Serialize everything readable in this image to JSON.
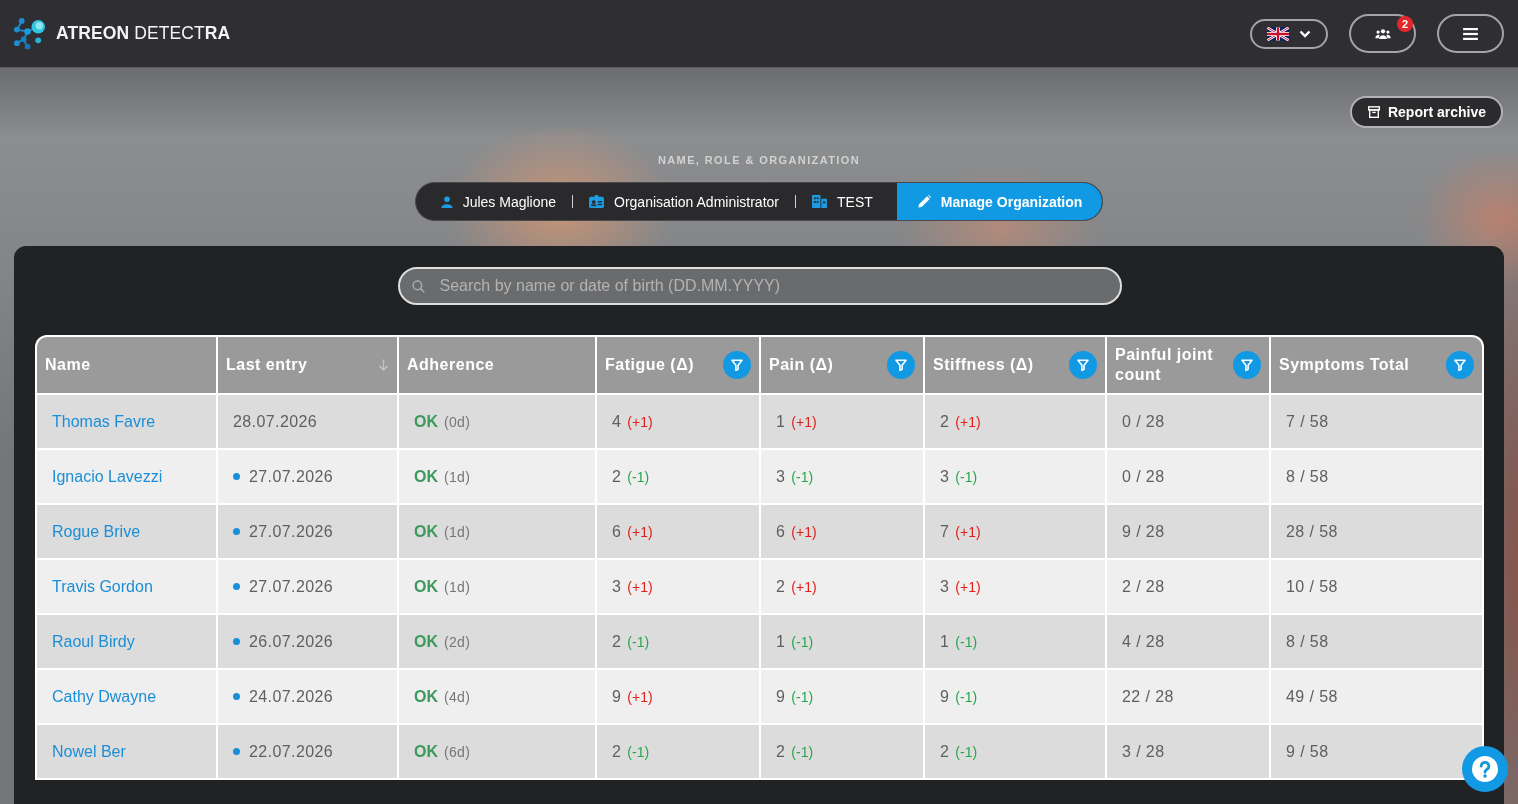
{
  "header": {
    "logo_text": "**ATREON** DETECT**RA**",
    "notification_count": "2"
  },
  "report_archive_button": "Report archive",
  "profile": {
    "section_label": "NAME, ROLE & ORGANIZATION",
    "name": "Jules Maglione",
    "role": "Organisation Administrator",
    "organization": "TEST",
    "manage_button": "Manage Organization"
  },
  "search": {
    "placeholder": "Search by name or date of birth (DD.MM.YYYY)"
  },
  "table": {
    "columns": [
      {
        "label": "Name",
        "filter": false,
        "sorted": false
      },
      {
        "label": "Last entry",
        "filter": false,
        "sorted": true
      },
      {
        "label": "Adherence",
        "filter": false,
        "sorted": false
      },
      {
        "label": "Fatigue (Δ)",
        "filter": true,
        "sorted": false
      },
      {
        "label": "Pain (Δ)",
        "filter": true,
        "sorted": false
      },
      {
        "label": "Stiffness (Δ)",
        "filter": true,
        "sorted": false
      },
      {
        "label": "Painful joint count",
        "filter": true,
        "sorted": false
      },
      {
        "label": "Symptoms Total",
        "filter": true,
        "sorted": false
      }
    ],
    "rows": [
      {
        "name": "Thomas Favre",
        "indicator": false,
        "last_entry": "28.07.2026",
        "adherence_status": "OK",
        "adherence_days": "(0d)",
        "scores": [
          {
            "value": "4",
            "delta": "(+1)",
            "increase": true
          },
          {
            "value": "1",
            "delta": "(+1)",
            "increase": true
          },
          {
            "value": "2",
            "delta": "(+1)",
            "increase": true
          }
        ],
        "painful_joint_count": "0 / 28",
        "symptoms_total": "7 / 58"
      },
      {
        "name": "Ignacio Lavezzi",
        "indicator": true,
        "last_entry": "27.07.2026",
        "adherence_status": "OK",
        "adherence_days": "(1d)",
        "scores": [
          {
            "value": "2",
            "delta": "(-1)",
            "increase": false
          },
          {
            "value": "3",
            "delta": "(-1)",
            "increase": false
          },
          {
            "value": "3",
            "delta": "(-1)",
            "increase": false
          }
        ],
        "painful_joint_count": "0 / 28",
        "symptoms_total": "8 / 58"
      },
      {
        "name": "Rogue Brive",
        "indicator": true,
        "last_entry": "27.07.2026",
        "adherence_status": "OK",
        "adherence_days": "(1d)",
        "scores": [
          {
            "value": "6",
            "delta": "(+1)",
            "increase": true
          },
          {
            "value": "6",
            "delta": "(+1)",
            "increase": true
          },
          {
            "value": "7",
            "delta": "(+1)",
            "increase": true
          }
        ],
        "painful_joint_count": "9 / 28",
        "symptoms_total": "28 / 58"
      },
      {
        "name": "Travis Gordon",
        "indicator": true,
        "last_entry": "27.07.2026",
        "adherence_status": "OK",
        "adherence_days": "(1d)",
        "scores": [
          {
            "value": "3",
            "delta": "(+1)",
            "increase": true
          },
          {
            "value": "2",
            "delta": "(+1)",
            "increase": true
          },
          {
            "value": "3",
            "delta": "(+1)",
            "increase": true
          }
        ],
        "painful_joint_count": "2 / 28",
        "symptoms_total": "10 / 58"
      },
      {
        "name": "Raoul Birdy",
        "indicator": true,
        "last_entry": "26.07.2026",
        "adherence_status": "OK",
        "adherence_days": "(2d)",
        "scores": [
          {
            "value": "2",
            "delta": "(-1)",
            "increase": false
          },
          {
            "value": "1",
            "delta": "(-1)",
            "increase": false
          },
          {
            "value": "1",
            "delta": "(-1)",
            "increase": false
          }
        ],
        "painful_joint_count": "4 / 28",
        "symptoms_total": "8 / 58"
      },
      {
        "name": "Cathy Dwayne",
        "indicator": true,
        "last_entry": "24.07.2026",
        "adherence_status": "OK",
        "adherence_days": "(4d)",
        "scores": [
          {
            "value": "9",
            "delta": "(+1)",
            "increase": true
          },
          {
            "value": "9",
            "delta": "(-1)",
            "increase": false
          },
          {
            "value": "9",
            "delta": "(-1)",
            "increase": false
          }
        ],
        "painful_joint_count": "22 / 28",
        "symptoms_total": "49 / 58"
      },
      {
        "name": "Nowel Ber",
        "indicator": true,
        "last_entry": "22.07.2026",
        "adherence_status": "OK",
        "adherence_days": "(6d)",
        "scores": [
          {
            "value": "2",
            "delta": "(-1)",
            "increase": false
          },
          {
            "value": "2",
            "delta": "(-1)",
            "increase": false
          },
          {
            "value": "2",
            "delta": "(-1)",
            "increase": false
          }
        ],
        "painful_joint_count": "3 / 28",
        "symptoms_total": "9 / 58"
      }
    ]
  }
}
